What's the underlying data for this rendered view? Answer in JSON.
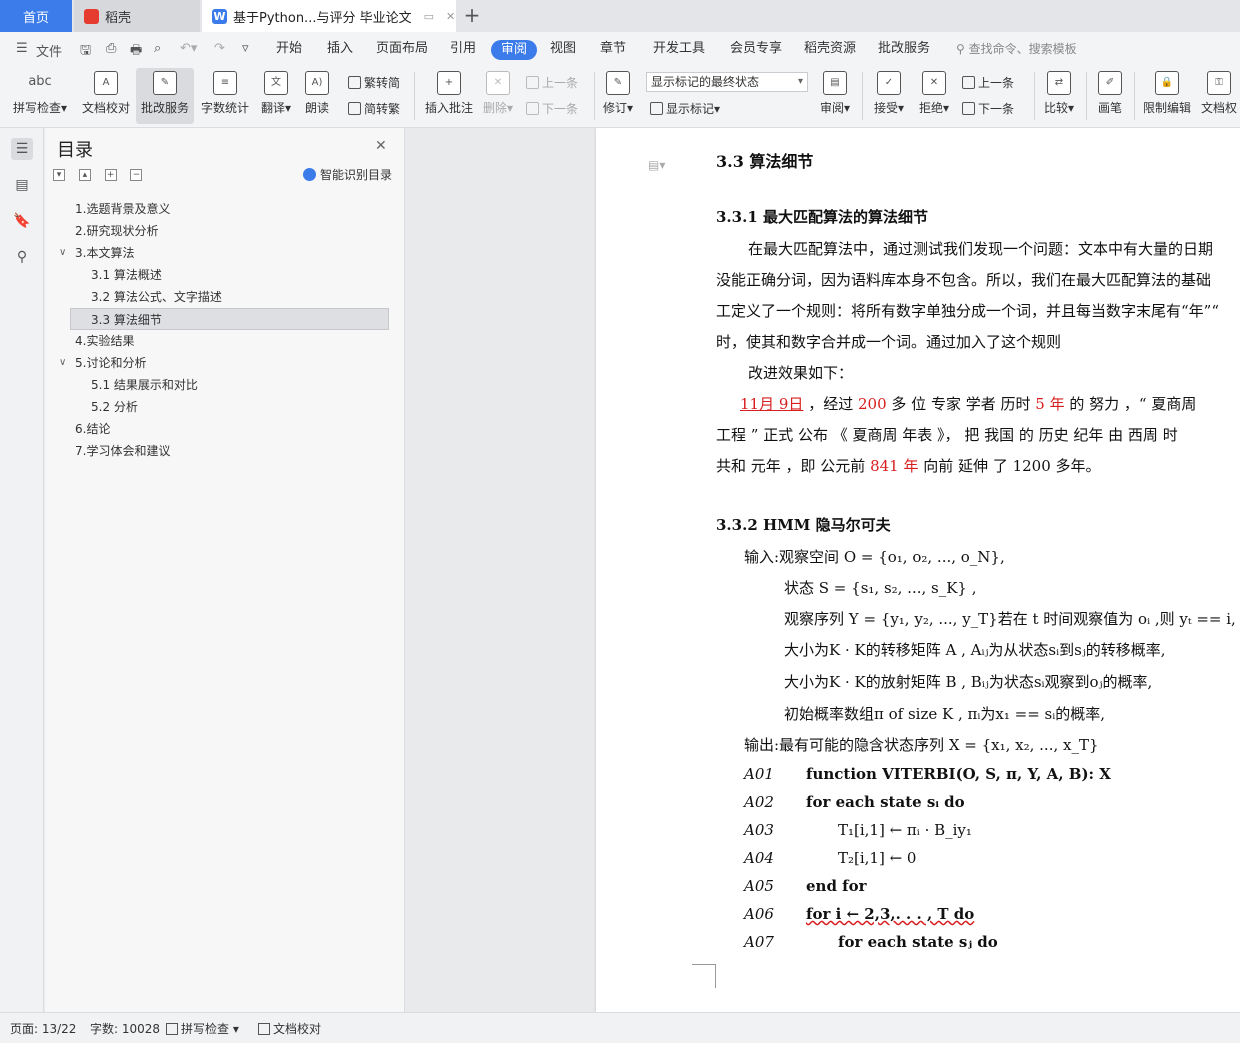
{
  "tabs": {
    "home": "首页",
    "daoke": "稻壳",
    "doc_title": "基于Python...与评分 毕业论文",
    "add": "+"
  },
  "menu": {
    "file": "文件",
    "items": [
      "开始",
      "插入",
      "页面布局",
      "引用",
      "审阅",
      "视图",
      "章节",
      "开发工具",
      "会员专享",
      "稻壳资源",
      "批改服务"
    ],
    "active": "审阅",
    "search_placeholder": "查找命令、搜索模板"
  },
  "ribbon": {
    "spell": "拼写检查",
    "doc_check": "文档校对",
    "review_service": "批改服务",
    "word_count": "字数统计",
    "translate": "翻译",
    "read_aloud": "朗读",
    "trad_to_simp": "繁转简",
    "simp_to_trad": "简转繁",
    "insert_comment": "插入批注",
    "delete": "删除",
    "prev": "上一条",
    "next": "下一条",
    "revise": "修订",
    "markup_select": "显示标记的最终状态",
    "show_markup": "显示标记",
    "review": "审阅",
    "accept": "接受",
    "reject": "拒绝",
    "prev2": "上一条",
    "next2": "下一条",
    "compare": "比较",
    "pen": "画笔",
    "restrict": "限制编辑",
    "doc_perm": "文档权"
  },
  "toc": {
    "title": "目录",
    "smart": "智能识别目录",
    "items": [
      {
        "label": "1.选题背景及意义",
        "level": 1
      },
      {
        "label": "2.研究现状分析",
        "level": 1
      },
      {
        "label": "3.本文算法",
        "level": 1,
        "expanded": true
      },
      {
        "label": "3.1  算法概述",
        "level": 2
      },
      {
        "label": "3.2  算法公式、文字描述",
        "level": 2
      },
      {
        "label": "3.3  算法细节",
        "level": 2,
        "selected": true
      },
      {
        "label": "4.实验结果",
        "level": 1
      },
      {
        "label": "5.讨论和分析",
        "level": 1,
        "expanded": true
      },
      {
        "label": "5.1 结果展示和对比",
        "level": 2
      },
      {
        "label": "5.2 分析",
        "level": 2
      },
      {
        "label": "6.结论",
        "level": 1
      },
      {
        "label": "7.学习体会和建议",
        "level": 1
      }
    ]
  },
  "doc": {
    "h_33": "3.3  算法细节",
    "h_331": "3.3.1  最大匹配算法的算法细节",
    "p1_l1": "在最大匹配算法中，通过测试我们发现一个问题：文本中有大量的日期",
    "p1_l2": "没能正确分词，因为语料库本身不包含。所以，我们在最大匹配算法的基础",
    "p1_l3": "工定义了一个规则：将所有数字单独分成一个词，并且每当数字末尾有“年”“",
    "p1_l4": "时，使其和数字合并成一个词。通过加入了这个规则",
    "p2": "改进效果如下：",
    "ex_date": "11月 9日",
    "ex_a": "，经过",
    "ex_200": "200",
    "ex_b": "多  位  专家  学者  历时",
    "ex_5y": "5 年",
    "ex_c": "的  努力 ，“ 夏商周",
    "ex_l2": "工程  ” 正式  公布 《 夏商周  年表 》， 把  我国  的  历史  纪年  由  西周  时",
    "ex_l3a": "共和  元年 ，即  公元前",
    "ex_841": "841 年",
    "ex_l3b": "向前  延伸  了 1200 多年。",
    "h_332": "3.3.2    HMM 隐马尔可夫",
    "in1": "输入:观察空间    O = {o₁, o₂, ..., o_N},",
    "in2": "状态    S = {s₁, s₂, ..., s_K} ,",
    "in3": "观察序列  Y = {y₁, y₂, ..., y_T}若在 t 时间观察值为   oᵢ ,则  yₜ == i,",
    "in4": "大小为K · K的转移矩阵 A , Aᵢⱼ为从状态sᵢ到sⱼ的转移概率,",
    "in5": "大小为K · K的放射矩阵 B , Bᵢⱼ为状态sᵢ观察到oⱼ的概率,",
    "in6": "初始概率数组π  of size K , πᵢ为x₁ == sᵢ的概率,",
    "out": "输出:最有可能的隐含状态序列  X = {x₁, x₂, ..., x_T}",
    "algo": [
      {
        "no": "A01",
        "text": "function  VITERBI(O, S, π, Y, A, B): X"
      },
      {
        "no": "A02",
        "text": "for each state  sᵢ  do"
      },
      {
        "no": "A03",
        "text": "T₁[i,1] ← πᵢ · B_iy₁"
      },
      {
        "no": "A04",
        "text": "T₂[i,1] ← 0"
      },
      {
        "no": "A05",
        "text": "end for"
      },
      {
        "no": "A06",
        "text": "for  i ← 2,3,. . . , T   do"
      },
      {
        "no": "A07",
        "text": "for each state  sⱼ  do"
      }
    ]
  },
  "status": {
    "page": "页面: 13/22",
    "words": "字数: 10028",
    "spell": "拼写检查",
    "proof": "文档校对"
  }
}
